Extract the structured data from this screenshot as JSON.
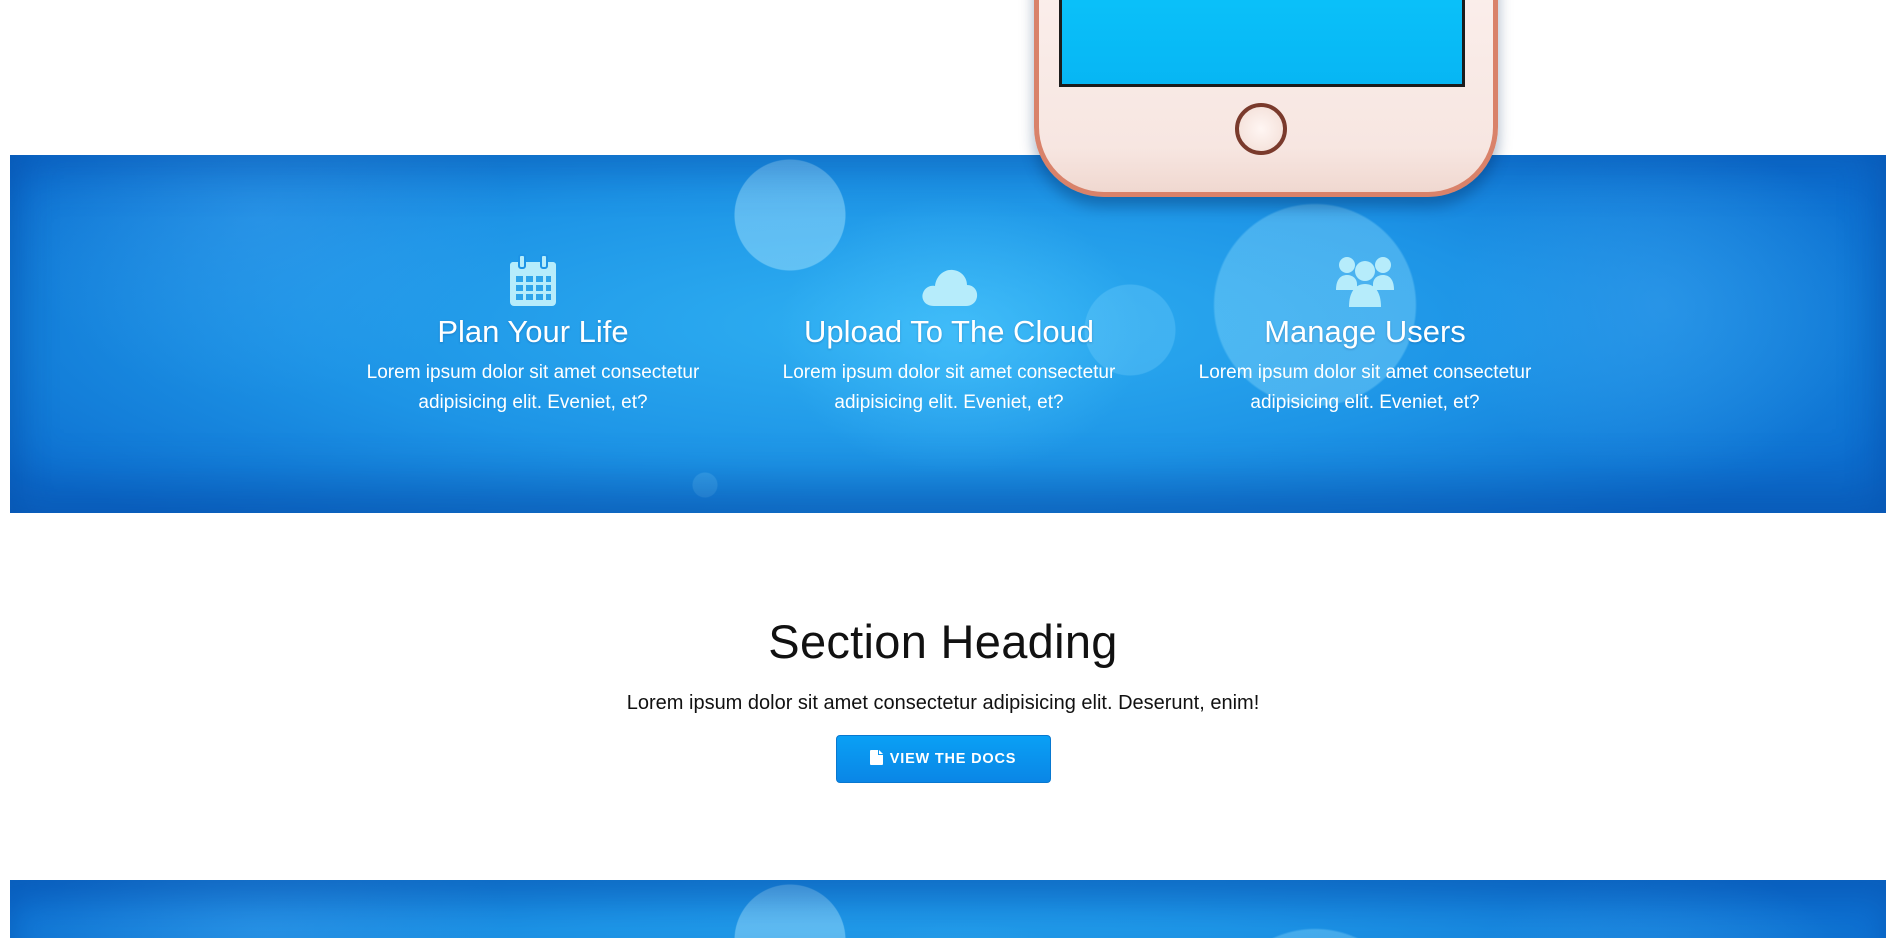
{
  "features": [
    {
      "icon": "calendar-icon",
      "title": "Plan Your Life",
      "description": "Lorem ipsum dolor sit amet consectetur adipisicing elit. Eveniet, et?"
    },
    {
      "icon": "cloud-icon",
      "title": "Upload To The Cloud",
      "description": "Lorem ipsum dolor sit amet consectetur adipisicing elit. Eveniet, et?"
    },
    {
      "icon": "users-icon",
      "title": "Manage Users",
      "description": "Lorem ipsum dolor sit amet consectetur adipisicing elit. Eveniet, et?"
    }
  ],
  "section": {
    "heading": "Section Heading",
    "text": "Lorem ipsum dolor sit amet consectetur adipisicing elit. Deserunt, enim!",
    "button_label": "VIEW THE DOCS",
    "button_icon": "file-icon"
  },
  "colors": {
    "band_blue": "#1d94e6",
    "button_blue": "#0a96ef",
    "phone_screen": "#0bc4fb",
    "phone_frame": "#d9826a"
  }
}
